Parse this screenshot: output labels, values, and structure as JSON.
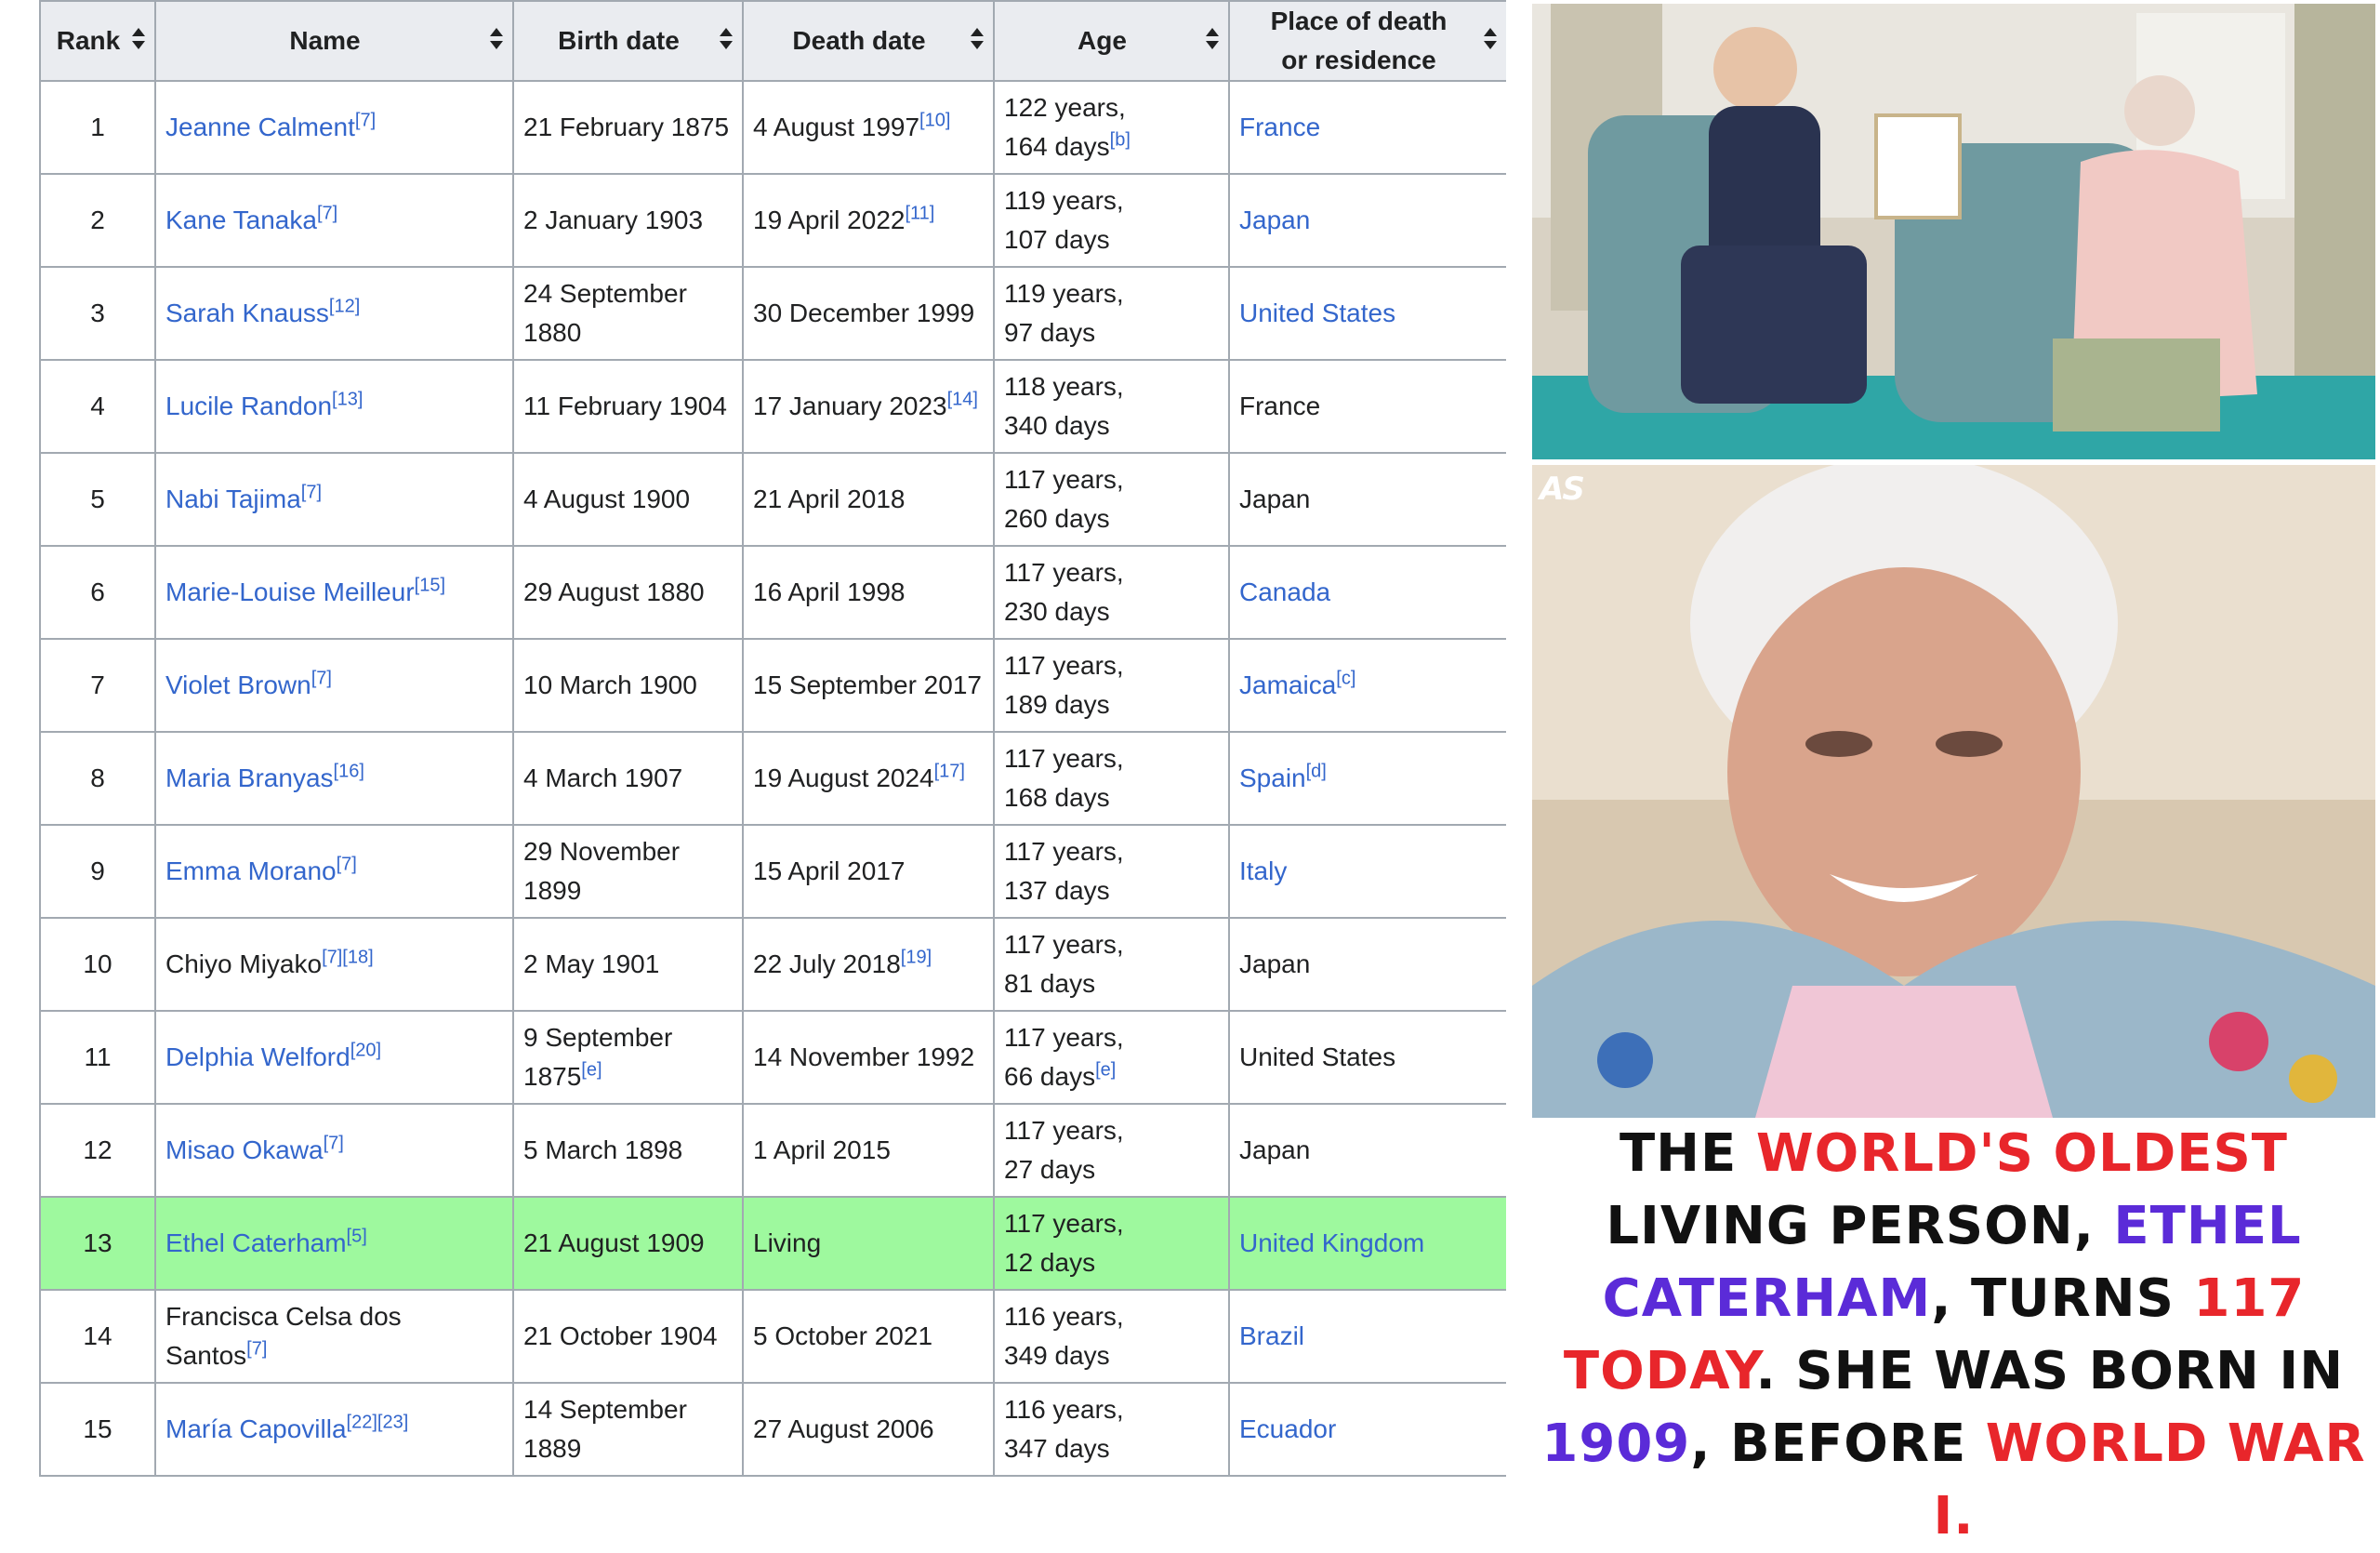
{
  "table": {
    "headers": {
      "rank": "Rank",
      "name": "Name",
      "birth": "Birth date",
      "death": "Death date",
      "age": "Age",
      "place_line1": "Place of death",
      "place_line2": "or residence"
    },
    "rows": [
      {
        "rank": "1",
        "name": "Jeanne Calment",
        "name_refs": "[7]",
        "name_link": true,
        "birth": "21 February 1875",
        "birth_refs": "",
        "death": "4 August 1997",
        "death_refs": "[10]",
        "age_line1": "122 years,",
        "age_line2": "164 days",
        "age_refs": "[b]",
        "place": "France",
        "place_refs": "",
        "place_link": true,
        "highlight": false
      },
      {
        "rank": "2",
        "name": "Kane Tanaka",
        "name_refs": "[7]",
        "name_link": true,
        "birth": "2 January 1903",
        "birth_refs": "",
        "death": "19 April 2022",
        "death_refs": "[11]",
        "age_line1": "119 years,",
        "age_line2": "107 days",
        "age_refs": "",
        "place": "Japan",
        "place_refs": "",
        "place_link": true,
        "highlight": false
      },
      {
        "rank": "3",
        "name": "Sarah Knauss",
        "name_refs": "[12]",
        "name_link": true,
        "birth": "24 September 1880",
        "birth_refs": "",
        "death": "30 December 1999",
        "death_refs": "",
        "age_line1": "119 years,",
        "age_line2": "97 days",
        "age_refs": "",
        "place": "United States",
        "place_refs": "",
        "place_link": true,
        "highlight": false
      },
      {
        "rank": "4",
        "name": "Lucile Randon",
        "name_refs": "[13]",
        "name_link": true,
        "birth": "11 February 1904",
        "birth_refs": "",
        "death": "17 January 2023",
        "death_refs": "[14]",
        "age_line1": "118 years,",
        "age_line2": "340 days",
        "age_refs": "",
        "place": "France",
        "place_refs": "",
        "place_link": false,
        "highlight": false
      },
      {
        "rank": "5",
        "name": "Nabi Tajima",
        "name_refs": "[7]",
        "name_link": true,
        "birth": "4 August 1900",
        "birth_refs": "",
        "death": "21 April 2018",
        "death_refs": "",
        "age_line1": "117 years,",
        "age_line2": "260 days",
        "age_refs": "",
        "place": "Japan",
        "place_refs": "",
        "place_link": false,
        "highlight": false
      },
      {
        "rank": "6",
        "name": "Marie-Louise Meilleur",
        "name_refs": "[15]",
        "name_link": true,
        "birth": "29 August 1880",
        "birth_refs": "",
        "death": "16 April 1998",
        "death_refs": "",
        "age_line1": "117 years,",
        "age_line2": "230 days",
        "age_refs": "",
        "place": "Canada",
        "place_refs": "",
        "place_link": true,
        "highlight": false
      },
      {
        "rank": "7",
        "name": "Violet Brown",
        "name_refs": "[7]",
        "name_link": true,
        "birth": "10 March 1900",
        "birth_refs": "",
        "death": "15 September 2017",
        "death_refs": "",
        "age_line1": "117 years,",
        "age_line2": "189 days",
        "age_refs": "",
        "place": "Jamaica",
        "place_refs": "[c]",
        "place_link": true,
        "highlight": false
      },
      {
        "rank": "8",
        "name": "Maria Branyas",
        "name_refs": "[16]",
        "name_link": true,
        "birth": "4 March 1907",
        "birth_refs": "",
        "death": "19 August 2024",
        "death_refs": "[17]",
        "age_line1": "117 years,",
        "age_line2": "168 days",
        "age_refs": "",
        "place": "Spain",
        "place_refs": "[d]",
        "place_link": true,
        "highlight": false
      },
      {
        "rank": "9",
        "name": "Emma Morano",
        "name_refs": "[7]",
        "name_link": true,
        "birth": "29 November 1899",
        "birth_refs": "",
        "death": "15 April 2017",
        "death_refs": "",
        "age_line1": "117 years,",
        "age_line2": "137 days",
        "age_refs": "",
        "place": "Italy",
        "place_refs": "",
        "place_link": true,
        "highlight": false
      },
      {
        "rank": "10",
        "name": "Chiyo Miyako",
        "name_refs": "[7][18]",
        "name_link": false,
        "birth": "2 May 1901",
        "birth_refs": "",
        "death": "22 July 2018",
        "death_refs": "[19]",
        "age_line1": "117 years,",
        "age_line2": "81 days",
        "age_refs": "",
        "place": "Japan",
        "place_refs": "",
        "place_link": false,
        "highlight": false
      },
      {
        "rank": "11",
        "name": "Delphia Welford",
        "name_refs": "[20]",
        "name_link": true,
        "birth": "9 September 1875",
        "birth_refs": "[e]",
        "death": "14 November 1992",
        "death_refs": "",
        "age_line1": "117 years,",
        "age_line2": "66 days",
        "age_refs": "[e]",
        "place": "United States",
        "place_refs": "",
        "place_link": false,
        "highlight": false
      },
      {
        "rank": "12",
        "name": "Misao Okawa",
        "name_refs": "[7]",
        "name_link": true,
        "birth": "5 March 1898",
        "birth_refs": "",
        "death": "1 April 2015",
        "death_refs": "",
        "age_line1": "117 years,",
        "age_line2": "27 days",
        "age_refs": "",
        "place": "Japan",
        "place_refs": "",
        "place_link": false,
        "highlight": false
      },
      {
        "rank": "13",
        "name": "Ethel Caterham",
        "name_refs": "[5]",
        "name_link": true,
        "birth": "21 August 1909",
        "birth_refs": "",
        "death": "Living",
        "death_refs": "",
        "age_line1": "117 years,",
        "age_line2": "12 days",
        "age_refs": "",
        "place": "United Kingdom",
        "place_refs": "",
        "place_link": true,
        "highlight": true
      },
      {
        "rank": "14",
        "name": "Francisca Celsa dos Santos",
        "name_refs": "[7]",
        "name_link": false,
        "birth": "21 October 1904",
        "birth_refs": "",
        "death": "5 October 2021",
        "death_refs": "",
        "age_line1": "116 years,",
        "age_line2": "349 days",
        "age_refs": "",
        "place": "Brazil",
        "place_refs": "",
        "place_link": true,
        "highlight": false
      },
      {
        "rank": "15",
        "name": "María Capovilla",
        "name_refs": "[22][23]",
        "name_link": true,
        "birth": "14 September 1889",
        "birth_refs": "",
        "death": "27 August 2006",
        "death_refs": "",
        "age_line1": "116 years,",
        "age_line2": "347 days",
        "age_refs": "",
        "place": "Ecuador",
        "place_refs": "",
        "place_link": true,
        "highlight": false
      }
    ]
  },
  "watermark": "AS",
  "caption": {
    "p1": "THE ",
    "p2": "WORLD'S OLDEST",
    "p3": " LIVING PERSON, ",
    "p4": "ETHEL CATERHAM",
    "p5": ", TURNS ",
    "p6": "117 TODAY",
    "p7": ". SHE WAS BORN IN ",
    "p8": "1909",
    "p9": ", BEFORE ",
    "p10": "WORLD WAR I."
  },
  "colors": {
    "link": "#3366cc",
    "highlight_row": "#9ef99e",
    "header_bg": "#eaecf0",
    "caption_red": "#e8262b",
    "caption_purple": "#5b2bd8"
  },
  "icons": [
    "sort-icon"
  ]
}
